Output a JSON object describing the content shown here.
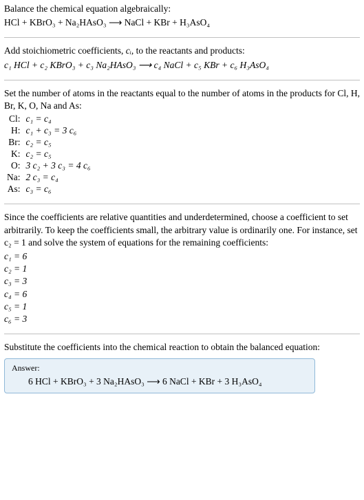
{
  "step1": {
    "text": "Balance the chemical equation algebraically:",
    "equation": "HCl + KBrO₃ + Na₂HAsO₃  ⟶  NaCl + KBr + H₃AsO₄"
  },
  "step2": {
    "text_before": "Add stoichiometric coefficients, ",
    "ci": "cᵢ",
    "text_after": ", to the reactants and products:",
    "equation": "c₁ HCl + c₂ KBrO₃ + c₃ Na₂HAsO₃  ⟶  c₄ NaCl + c₅ KBr + c₆ H₃AsO₄"
  },
  "step3": {
    "text": "Set the number of atoms in the reactants equal to the number of atoms in the products for Cl, H, Br, K, O, Na and As:",
    "rows": [
      {
        "label": "Cl:",
        "eq": "c₁ = c₄"
      },
      {
        "label": "H:",
        "eq": "c₁ + c₃ = 3 c₆"
      },
      {
        "label": "Br:",
        "eq": "c₂ = c₅"
      },
      {
        "label": "K:",
        "eq": "c₂ = c₅"
      },
      {
        "label": "O:",
        "eq": "3 c₂ + 3 c₃ = 4 c₆"
      },
      {
        "label": "Na:",
        "eq": "2 c₃ = c₄"
      },
      {
        "label": "As:",
        "eq": "c₃ = c₆"
      }
    ]
  },
  "step4": {
    "text": "Since the coefficients are relative quantities and underdetermined, choose a coefficient to set arbitrarily. To keep the coefficients small, the arbitrary value is ordinarily one. For instance, set c₂ = 1 and solve the system of equations for the remaining coefficients:",
    "coefs": [
      "c₁ = 6",
      "c₂ = 1",
      "c₃ = 3",
      "c₄ = 6",
      "c₅ = 1",
      "c₆ = 3"
    ]
  },
  "step5": {
    "text": "Substitute the coefficients into the chemical reaction to obtain the balanced equation:"
  },
  "answer": {
    "label": "Answer:",
    "equation": "6 HCl + KBrO₃ + 3 Na₂HAsO₃  ⟶  6 NaCl + KBr + 3 H₃AsO₄"
  }
}
